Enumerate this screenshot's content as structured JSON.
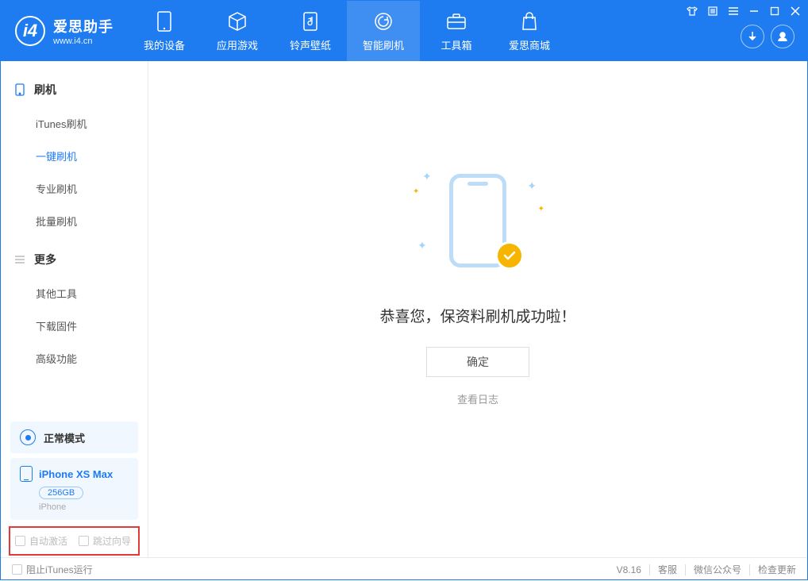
{
  "app": {
    "name_cn": "爱思助手",
    "name_en": "www.i4.cn"
  },
  "nav": {
    "device": "我的设备",
    "apps": "应用游戏",
    "ring": "铃声壁纸",
    "flash": "智能刷机",
    "toolbox": "工具箱",
    "store": "爱思商城"
  },
  "sidebar": {
    "group_flash": "刷机",
    "group_more": "更多",
    "items": {
      "itunes": "iTunes刷机",
      "oneclick": "一键刷机",
      "pro": "专业刷机",
      "batch": "批量刷机",
      "other": "其他工具",
      "firmware": "下载固件",
      "advanced": "高级功能"
    }
  },
  "mode": {
    "label": "正常模式"
  },
  "device": {
    "name": "iPhone XS Max",
    "storage": "256GB",
    "type": "iPhone"
  },
  "options": {
    "auto_activate": "自动激活",
    "skip_guide": "跳过向导"
  },
  "status": {
    "block_itunes": "阻止iTunes运行",
    "version": "V8.16",
    "support": "客服",
    "wechat": "微信公众号",
    "update": "检查更新"
  },
  "main": {
    "message": "恭喜您，保资料刷机成功啦！",
    "ok": "确定",
    "view_log": "查看日志"
  }
}
